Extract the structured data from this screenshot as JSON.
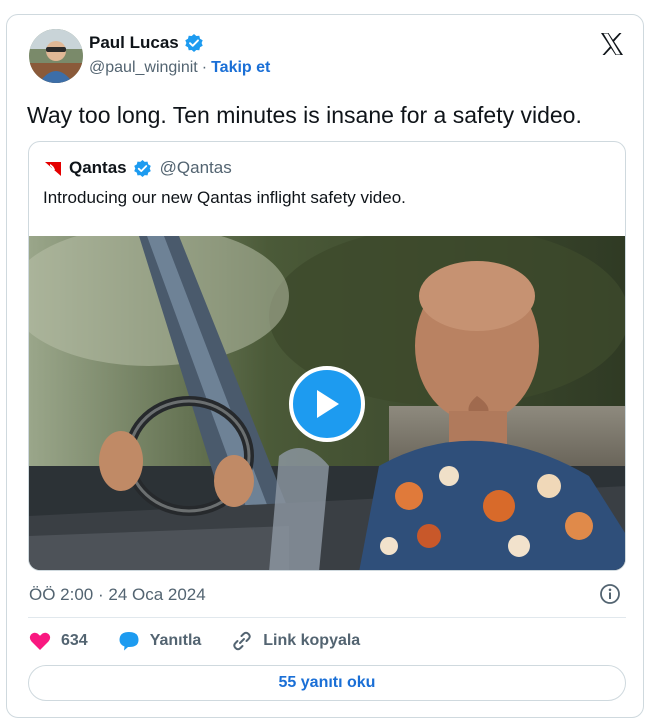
{
  "author": {
    "display_name": "Paul Lucas",
    "handle": "@paul_winginit",
    "separator": "·",
    "follow_label": "Takip et",
    "verified": true
  },
  "tweet": {
    "text": "Way too long. Ten minutes is insane for a safety video."
  },
  "quoted": {
    "display_name": "Qantas",
    "handle": "@Qantas",
    "verified": true,
    "text": "Introducing our new Qantas inflight safety video."
  },
  "meta": {
    "timestamp": "ÖÖ 2:00 · 24 Oca 2024"
  },
  "actions": {
    "like_count": "634",
    "reply_label": "Yanıtla",
    "copy_link_label": "Link kopyala"
  },
  "footer": {
    "read_replies_label": "55 yanıtı oku"
  },
  "colors": {
    "accent": "#1d9bf0",
    "link": "#1a6fd6",
    "like": "#f91880",
    "muted": "#536471"
  },
  "icons": [
    "verified-badge-icon",
    "x-logo-icon",
    "qantas-logo-icon",
    "play-icon",
    "info-icon",
    "heart-icon",
    "reply-bubble-icon",
    "link-icon"
  ]
}
